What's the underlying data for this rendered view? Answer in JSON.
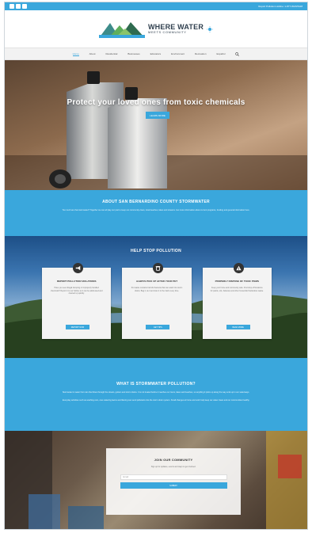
{
  "topbar": {
    "hotline": "Report Pollution Hotline: 1-877-WASTE18",
    "social_icons": [
      "facebook-icon",
      "twitter-icon",
      "instagram-icon"
    ]
  },
  "header": {
    "logo_line1": "WHERE WATER",
    "logo_line2": "MEETS COMMUNITY"
  },
  "nav": {
    "items": [
      {
        "label": "Home",
        "active": true
      },
      {
        "label": "About",
        "active": false
      },
      {
        "label": "Residential",
        "active": false
      },
      {
        "label": "Businesses",
        "active": false
      },
      {
        "label": "Educators",
        "active": false
      },
      {
        "label": "Environment",
        "active": false
      },
      {
        "label": "Recreation",
        "active": false
      },
      {
        "label": "Español",
        "active": false
      }
    ]
  },
  "hero": {
    "title": "Protect your loved ones from toxic chemicals",
    "button_label": "LEARN MORE"
  },
  "about": {
    "heading": "ABOUT SAN BERNARDINO COUNTY STORMWATER",
    "text": "Too much are that stormwater? Together we can all play our part to keep our community clean, local beaches, lakes and streams. Get more information about current programs, funding and general information here."
  },
  "pollution": {
    "heading": "HELP STOP POLLUTION",
    "cards": [
      {
        "icon": "megaphone-icon",
        "title": "REPORT POLLUTION VIOLATIONS",
        "desc": "Have you seen illegal dumping or improperly handled chemicals? Report it to our hotline so it can be addressed and cleaned up quickly.",
        "button": "REPORT NOW"
      },
      {
        "icon": "trash-bag-icon",
        "title": "ALWAYS PICK UP AFTER YOUR PET",
        "desc": "Pet waste contains harmful bacteria that can wash into storm drains. Bag it, tie it and toss it in the trash every time.",
        "button": "GET TIPS"
      },
      {
        "icon": "warning-icon",
        "title": "PROPERLY DISPOSE OF TOXIC ITEMS",
        "desc": "Keep your home and community safe. Find drop-off locations for paints, oils, batteries and other household hazardous waste.",
        "button": "READ MORE"
      }
    ]
  },
  "storm": {
    "heading": "WHAT IS STORMWATER POLLUTION?",
    "p1": "Stormwater is water from rain that flows through the streets, gutters and storm drains. It is not treated before it reaches our rivers, lakes and beaches, so anything it picks up along the way ends up in our waterways.",
    "p2": "Everyday activities such as washing cars, over-watering lawns and littering can send pollutants into the storm drain system. Small changes at home and work help keep our water clean and our communities healthy."
  },
  "community": {
    "heading": "JOIN OUR COMMUNITY",
    "subtitle": "Sign up for updates, events and ways to get involved.",
    "email_placeholder": "Email",
    "submit_label": "SUBMIT"
  },
  "colors": {
    "accent": "#3aa7dc",
    "dark_text": "#333333"
  }
}
